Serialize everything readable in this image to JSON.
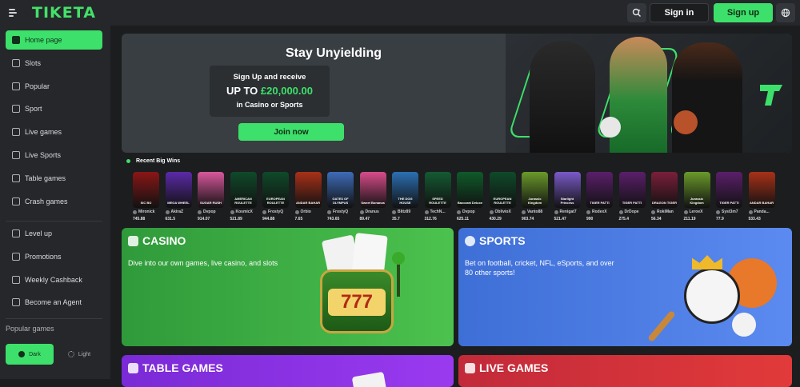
{
  "header": {
    "logo": "TIKETA",
    "signin_label": "Sign in",
    "signup_label": "Sign up"
  },
  "sidebar": {
    "items": [
      {
        "label": "Home page",
        "icon": "home-icon",
        "active": true
      },
      {
        "label": "Slots",
        "icon": "slots-icon"
      },
      {
        "label": "Popular",
        "icon": "popular-icon"
      },
      {
        "label": "Sport",
        "icon": "sport-icon"
      },
      {
        "label": "Live games",
        "icon": "live-games-icon"
      },
      {
        "label": "Live Sports",
        "icon": "live-sports-icon"
      },
      {
        "label": "Table games",
        "icon": "table-games-icon"
      },
      {
        "label": "Crash games",
        "icon": "crash-games-icon"
      }
    ],
    "items2": [
      {
        "label": "Level up",
        "icon": "level-up-icon"
      },
      {
        "label": "Promotions",
        "icon": "promotions-icon"
      },
      {
        "label": "Weekly Cashback",
        "icon": "cashback-icon"
      },
      {
        "label": "Become an Agent",
        "icon": "agent-icon"
      }
    ],
    "popular_games_label": "Popular games",
    "theme_dark": "Dark",
    "theme_light": "Light"
  },
  "banner": {
    "title": "Stay Unyielding",
    "line1": "Sign Up and receive",
    "line2_prefix": "UP TO",
    "line2_amount": "£20,000.00",
    "line3": "in Casino or Sports",
    "cta": "Join now"
  },
  "recent_wins": {
    "title": "Recent Big Wins",
    "games": [
      {
        "name": "SIC BO",
        "color": "#8a1616",
        "user": "Mironick",
        "amount": "745.88"
      },
      {
        "name": "MEGA WHEEL",
        "color": "#5b2aa8",
        "user": "AkiraZ",
        "amount": "631.5"
      },
      {
        "name": "SUGAR RUSH",
        "color": "#d8589c",
        "user": "Dvpop",
        "amount": "914.07"
      },
      {
        "name": "AMERICAN ROULETTE",
        "color": "#0f4a2a",
        "user": "KosmicX",
        "amount": "521.89"
      },
      {
        "name": "EUROPEAN ROULETTE",
        "color": "#0f4a2a",
        "user": "FrostyQ",
        "amount": "944.88"
      },
      {
        "name": "ANDAR BAHAR",
        "color": "#a83118",
        "user": "Orbio",
        "amount": "7.65"
      },
      {
        "name": "GATES OF OLYMPUS",
        "color": "#3e6bb8",
        "user": "FrostyQ",
        "amount": "743.65"
      },
      {
        "name": "Sweet Bonanza",
        "color": "#d84c8a",
        "user": "Dranus",
        "amount": "89.47"
      },
      {
        "name": "THE DOG HOUSE",
        "color": "#2b6fb3",
        "user": "Blitz89",
        "amount": "35.7"
      },
      {
        "name": "SPEED ROULETTE",
        "color": "#145a33",
        "user": "TechN...",
        "amount": "312.76"
      },
      {
        "name": "Baccarat Deluxe",
        "color": "#0f5a2a",
        "user": "Dvpop",
        "amount": "625.11"
      },
      {
        "name": "EUROPEAN ROULETTE",
        "color": "#0f4a2a",
        "user": "OblivioX",
        "amount": "430.29"
      },
      {
        "name": "Jurassic Kingdom",
        "color": "#6a9a2a",
        "user": "Vanto88",
        "amount": "903.74"
      },
      {
        "name": "Starlight Princess",
        "color": "#7a5ac8",
        "user": "Renigat7",
        "amount": "521.47"
      },
      {
        "name": "TIGER PATTI",
        "color": "#5a1f6a",
        "user": "RodexX",
        "amount": "990"
      },
      {
        "name": "TIGER PATTI",
        "color": "#5a1f6a",
        "user": "DrDope",
        "amount": "275.4"
      },
      {
        "name": "DRAGON TIGER",
        "color": "#7a1f3a",
        "user": "RokiMan",
        "amount": "56.34"
      },
      {
        "name": "Jurassic Kingdom",
        "color": "#6a9a2a",
        "user": "LeroeX",
        "amount": "211.19"
      },
      {
        "name": "TIGER PATTI",
        "color": "#5a1f6a",
        "user": "Syst3m7",
        "amount": "77.9"
      },
      {
        "name": "ANDAR BAHAR",
        "color": "#a83118",
        "user": "Panda...",
        "amount": "533.43"
      }
    ]
  },
  "casino": {
    "title": "CASINO",
    "desc": "Dive into our own games, live casino, and slots"
  },
  "sports": {
    "title": "SPORTS",
    "desc1": "Bet on football, cricket, NFL, eSports, and over",
    "desc2": "80 other sports!"
  },
  "table_games": {
    "title": "TABLE GAMES"
  },
  "live_games": {
    "title": "LIVE GAMES"
  }
}
